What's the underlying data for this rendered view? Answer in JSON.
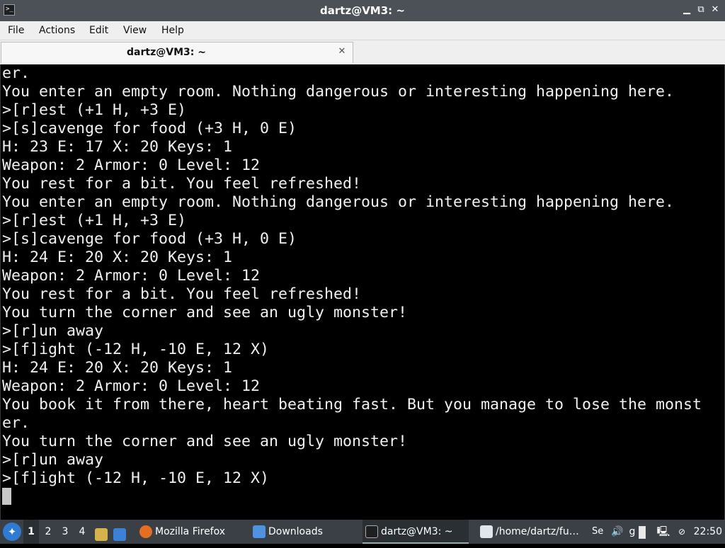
{
  "window": {
    "title": "dartz@VM3: ~",
    "icon": "terminal-icon",
    "controls": {
      "minimize": "▁",
      "restore": "⧉",
      "close": "✕"
    }
  },
  "menu": [
    "File",
    "Actions",
    "Edit",
    "View",
    "Help"
  ],
  "tab": {
    "label": "dartz@VM3: ~",
    "close": "✕"
  },
  "terminal": {
    "lines": [
      "er.",
      "You enter an empty room. Nothing dangerous or interesting happening here.",
      ">[r]est (+1 H, +3 E)",
      ">[s]cavenge for food (+3 H, 0 E)",
      "H: 23 E: 17 X: 20 Keys: 1",
      "Weapon: 2 Armor: 0 Level: 12",
      "You rest for a bit. You feel refreshed!",
      "You enter an empty room. Nothing dangerous or interesting happening here.",
      ">[r]est (+1 H, +3 E)",
      ">[s]cavenge for food (+3 H, 0 E)",
      "H: 24 E: 20 X: 20 Keys: 1",
      "Weapon: 2 Armor: 0 Level: 12",
      "You rest for a bit. You feel refreshed!",
      "You turn the corner and see an ugly monster!",
      ">[r]un away",
      ">[f]ight (-12 H, -10 E, 12 X)",
      "H: 24 E: 20 X: 20 Keys: 1",
      "Weapon: 2 Armor: 0 Level: 12",
      "You book it from there, heart beating fast. But you manage to lose the monst",
      "er.",
      "You turn the corner and see an ugly monster!",
      ">[r]un away",
      ">[f]ight (-12 H, -10 E, 12 X)"
    ]
  },
  "taskbar": {
    "workspaces": [
      "1",
      "2",
      "3",
      "4"
    ],
    "active_workspace": "1",
    "tasks": [
      {
        "label": "Mozilla Firefox",
        "icon": "firefox-icon"
      },
      {
        "label": "Downloads",
        "icon": "folder-icon"
      },
      {
        "label": "dartz@VM3: ~",
        "icon": "terminal-icon"
      },
      {
        "label": "/home/dartz/fu…",
        "icon": "text-editor-icon"
      }
    ],
    "tray_fragment": "Se",
    "tray_letter": "g",
    "clock": "22:50"
  },
  "colors": {
    "titlebar": "#4b5156",
    "terminal_bg": "#000000",
    "terminal_fg": "#f0f0f0",
    "taskbar": "#3a4045",
    "start_button": "#2e7bd1"
  }
}
